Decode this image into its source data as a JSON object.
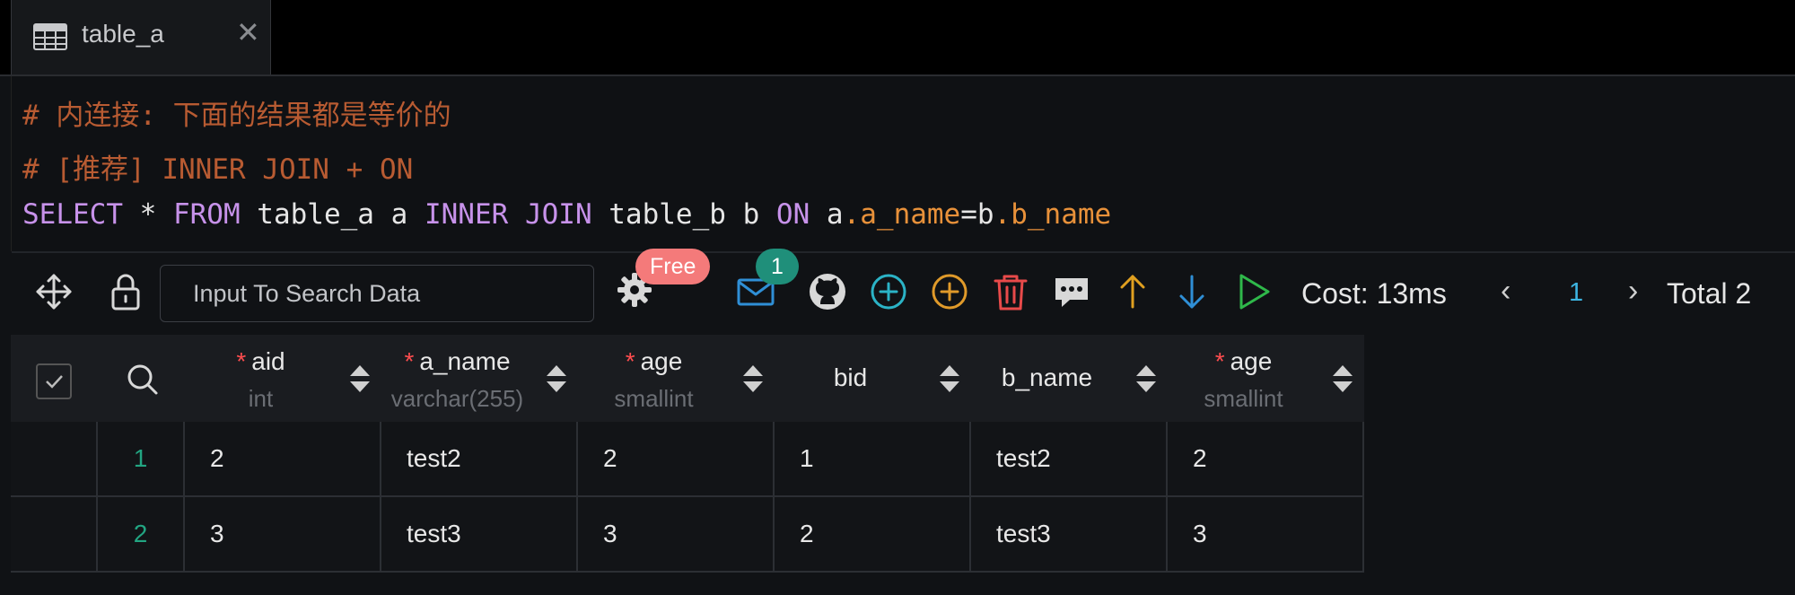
{
  "tab": {
    "label": "table_a"
  },
  "editor": {
    "comment1": "# 内连接: 下面的结果都是等价的",
    "comment2": "# [推荐] INNER JOIN + ON",
    "sql": {
      "kw_select": "SELECT",
      "star": " * ",
      "kw_from": "FROM",
      "t1": " table_a a ",
      "kw_inner": "INNER",
      "sp1": " ",
      "kw_join": "JOIN",
      "t2": " table_b b ",
      "kw_on": "ON",
      "p1": " a",
      "f1": ".a_name",
      "eq": "=b",
      "f2": ".b_name"
    }
  },
  "toolbar": {
    "search_placeholder": "Input To Search Data",
    "free_badge": "Free",
    "mail_count": "1",
    "cost": "Cost: 13ms",
    "page": "1",
    "total": "Total 2"
  },
  "grid": {
    "columns": [
      {
        "name": "aid",
        "type": "int",
        "required": "*"
      },
      {
        "name": "a_name",
        "type": "varchar(255)",
        "required": "*"
      },
      {
        "name": "age",
        "type": "smallint",
        "required": "*"
      },
      {
        "name": "bid",
        "type": "",
        "required": ""
      },
      {
        "name": "b_name",
        "type": "",
        "required": ""
      },
      {
        "name": "age",
        "type": "smallint",
        "required": "*"
      }
    ],
    "rows": [
      {
        "num": "1",
        "cells": [
          "2",
          "test2",
          "2",
          "1",
          "test2",
          "2"
        ]
      },
      {
        "num": "2",
        "cells": [
          "3",
          "test3",
          "3",
          "2",
          "test3",
          "3"
        ]
      }
    ]
  },
  "colors": {
    "accent": "#3db4e0",
    "comment": "#b85b32",
    "keyword": "#c792ea",
    "field": "#e8913a",
    "rownum": "#22a582"
  }
}
